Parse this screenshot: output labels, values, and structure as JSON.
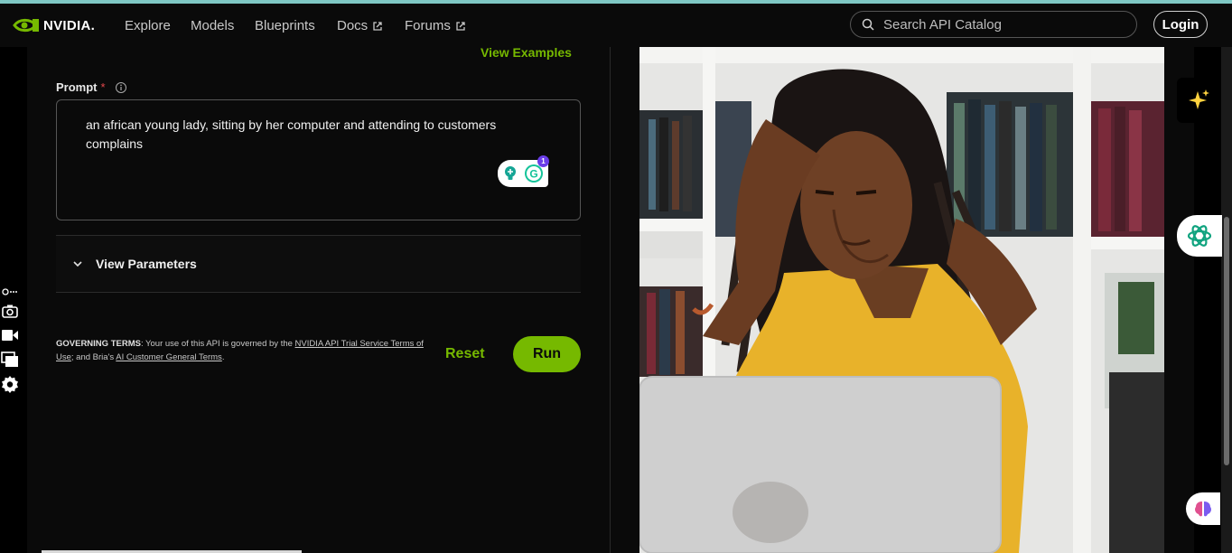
{
  "nav": {
    "brand": "NVIDIA.",
    "links": [
      {
        "label": "Explore"
      },
      {
        "label": "Models"
      },
      {
        "label": "Blueprints"
      },
      {
        "label": "Docs"
      },
      {
        "label": "Forums"
      }
    ],
    "search_placeholder": "Search API Catalog",
    "login_label": "Login"
  },
  "form": {
    "view_examples": "View Examples",
    "prompt_label": "Prompt",
    "required_mark": "*",
    "prompt_value": "an african young lady, sitting by her computer and attending to customers complains",
    "grammarly_count": "1",
    "view_parameters": "View Parameters",
    "terms": {
      "heading": "GOVERNING TERMS",
      "text1": ": Your use of this API is governed by the ",
      "link1": "NVIDIA API Trial Service Terms of Use",
      "text2": "; and Bria's ",
      "link2": "AI Customer General Terms",
      "text3": "."
    },
    "reset_label": "Reset",
    "run_label": "Run"
  },
  "colors": {
    "accent": "#76b900",
    "background": "#0a0a0a",
    "top_line": "#7fc8c4"
  }
}
